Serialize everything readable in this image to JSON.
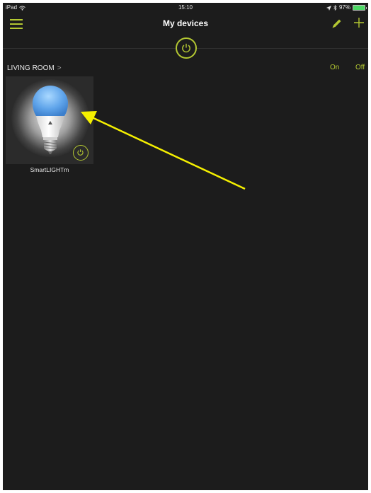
{
  "status_bar": {
    "device": "iPad",
    "time": "15:10",
    "battery_text": "97%",
    "battery_level": 0.97
  },
  "nav": {
    "title": "My devices"
  },
  "room": {
    "name": "LIVING ROOM",
    "chevron": ">",
    "on_label": "On",
    "off_label": "Off"
  },
  "devices": [
    {
      "name": "SmartLIGHTm"
    }
  ],
  "colors": {
    "accent": "#b4c832",
    "background": "#1c1c1c",
    "tile": "#2b2b2b",
    "annotation_arrow": "#f5f000"
  }
}
